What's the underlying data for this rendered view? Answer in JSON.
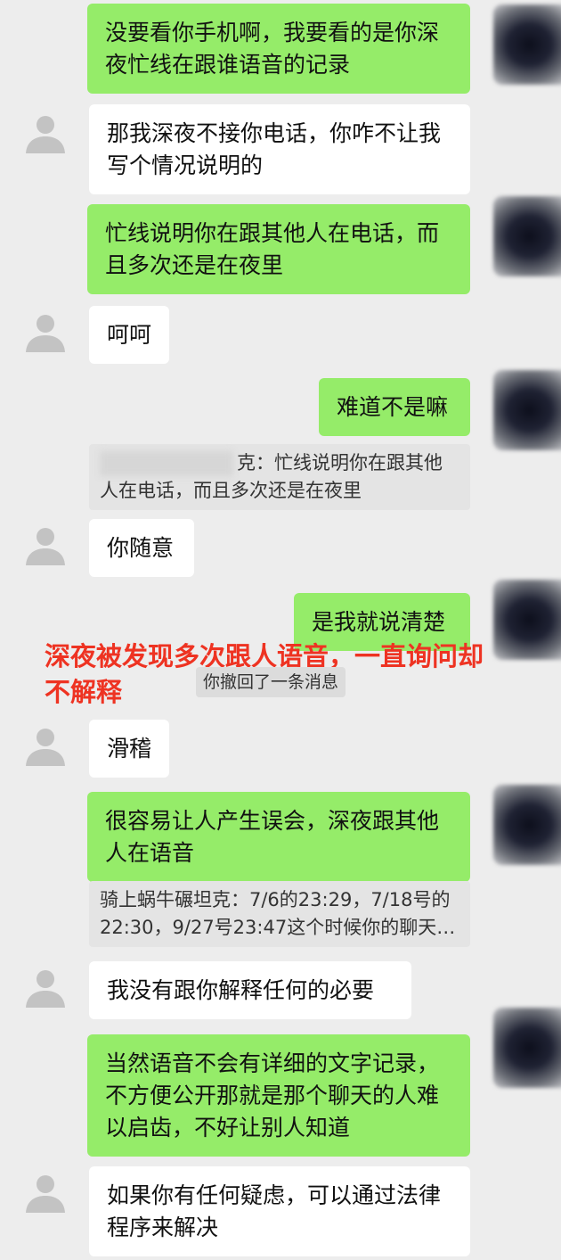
{
  "messages": [
    {
      "id": "m1",
      "side": "right",
      "text": "没要看你手机啊，我要看的是你深夜忙线在跟谁语音的记录"
    },
    {
      "id": "m2",
      "side": "left",
      "text": "那我深夜不接你电话，你咋不让我写个情况说明的"
    },
    {
      "id": "m3",
      "side": "right",
      "text": "忙线说明你在跟其他人在电话，而且多次还是在夜里"
    },
    {
      "id": "m4",
      "side": "left",
      "text": "呵呵"
    },
    {
      "id": "m5",
      "side": "right",
      "text": "难道不是嘛"
    },
    {
      "id": "m6",
      "side": "left",
      "text": "你随意"
    },
    {
      "id": "m7",
      "side": "right",
      "text": "是我就说清楚"
    },
    {
      "id": "m8",
      "side": "left",
      "text": "滑稽"
    },
    {
      "id": "m9",
      "side": "right",
      "text": "很容易让人产生误会，深夜跟其他人在语音"
    },
    {
      "id": "m10",
      "side": "left",
      "text": "我没有跟你解释任何的必要"
    },
    {
      "id": "m11",
      "side": "right",
      "text": "当然语音不会有详细的文字记录，不方便公开那就是那个聊天的人难以启齿，不好让别人知道"
    },
    {
      "id": "m12",
      "side": "left",
      "text": "如果你有任何疑虑，可以通过法律程序来解决"
    }
  ],
  "quote1": {
    "suffix": "克：忙线说明你在跟其他人在电话，而且多次还是在夜里"
  },
  "quote2": {
    "text": "骑上蜗牛碾坦克：7/6的23:29，7/18号的22:30，9/27号23:47这个时候你的聊天…"
  },
  "system": {
    "recall": "你撤回了一条消息"
  },
  "annotation": {
    "text": "深夜被发现多次跟人语音，一直询问却不解释"
  },
  "colors": {
    "green_bubble": "#95ec69",
    "white_bubble": "#ffffff",
    "annotation": "#ee3322",
    "background": "#ededed"
  }
}
